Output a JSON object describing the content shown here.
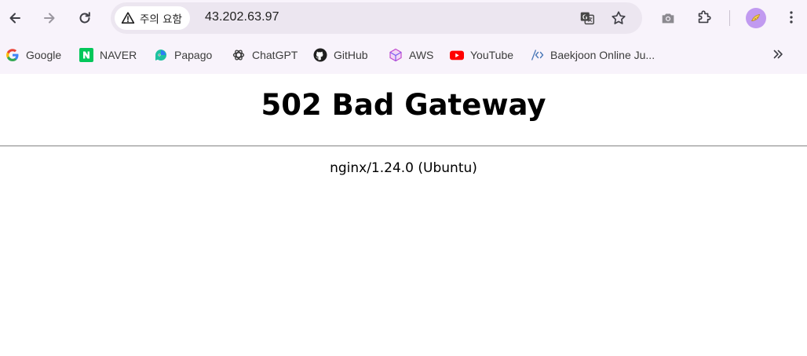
{
  "browser": {
    "security_chip": {
      "label": "주의 요함",
      "icon": "warning-triangle-icon"
    },
    "url": "43.202.63.97",
    "toolbar_icons": [
      "back-arrow-icon",
      "forward-arrow-icon",
      "reload-icon",
      "translate-icon",
      "star-icon",
      "screenshot-icon",
      "extensions-icon",
      "avatar",
      "menu-icon"
    ],
    "accent_color": "#c19af0"
  },
  "bookmarks": [
    {
      "label": "Google",
      "icon": "google-icon"
    },
    {
      "label": "NAVER",
      "icon": "naver-icon"
    },
    {
      "label": "Papago",
      "icon": "papago-icon"
    },
    {
      "label": "ChatGPT",
      "icon": "chatgpt-icon"
    },
    {
      "label": "GitHub",
      "icon": "github-icon"
    },
    {
      "label": "AWS",
      "icon": "aws-icon"
    },
    {
      "label": "YouTube",
      "icon": "youtube-icon"
    },
    {
      "label": "Baekjoon Online Ju...",
      "icon": "code-icon"
    }
  ],
  "page": {
    "title": "502 Bad Gateway",
    "server": "nginx/1.24.0 (Ubuntu)"
  }
}
